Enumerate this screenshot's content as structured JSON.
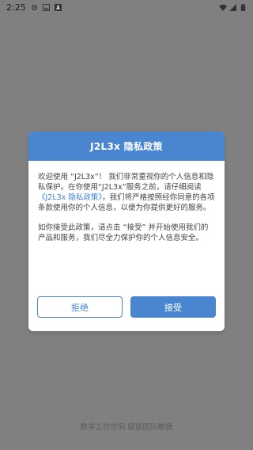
{
  "status_bar": {
    "time": "2:25",
    "icons": [
      "gear-icon",
      "image-icon",
      "app-a-icon",
      "wifi-icon",
      "signal-icon",
      "battery-icon"
    ]
  },
  "dialog": {
    "title": "J2L3x 隐私政策",
    "para1_before_link": "欢迎使用 “J2L3x”！ 我们非常重视你的个人信息和隐私保护。在你使用“J2L3x”服务之前，请仔细阅读",
    "policy_link": "《J2L3x 隐私政策》",
    "para1_after_link": "，我们将严格按照经你同意的各项条款使用你的个人信息，以便为你提供更好的服务。",
    "para2": "如你接受此政策，请点击 “接受” 并开始使用我们的产品和服务，我们尽全力保护你的个人信息安全。",
    "reject_label": "拒绝",
    "accept_label": "接受"
  },
  "footer": {
    "slogan": "数字工作空间 赋能团队敏捷"
  },
  "colors": {
    "overlay": "#808080",
    "accent": "#4a86cf",
    "link": "#3b82d8"
  }
}
